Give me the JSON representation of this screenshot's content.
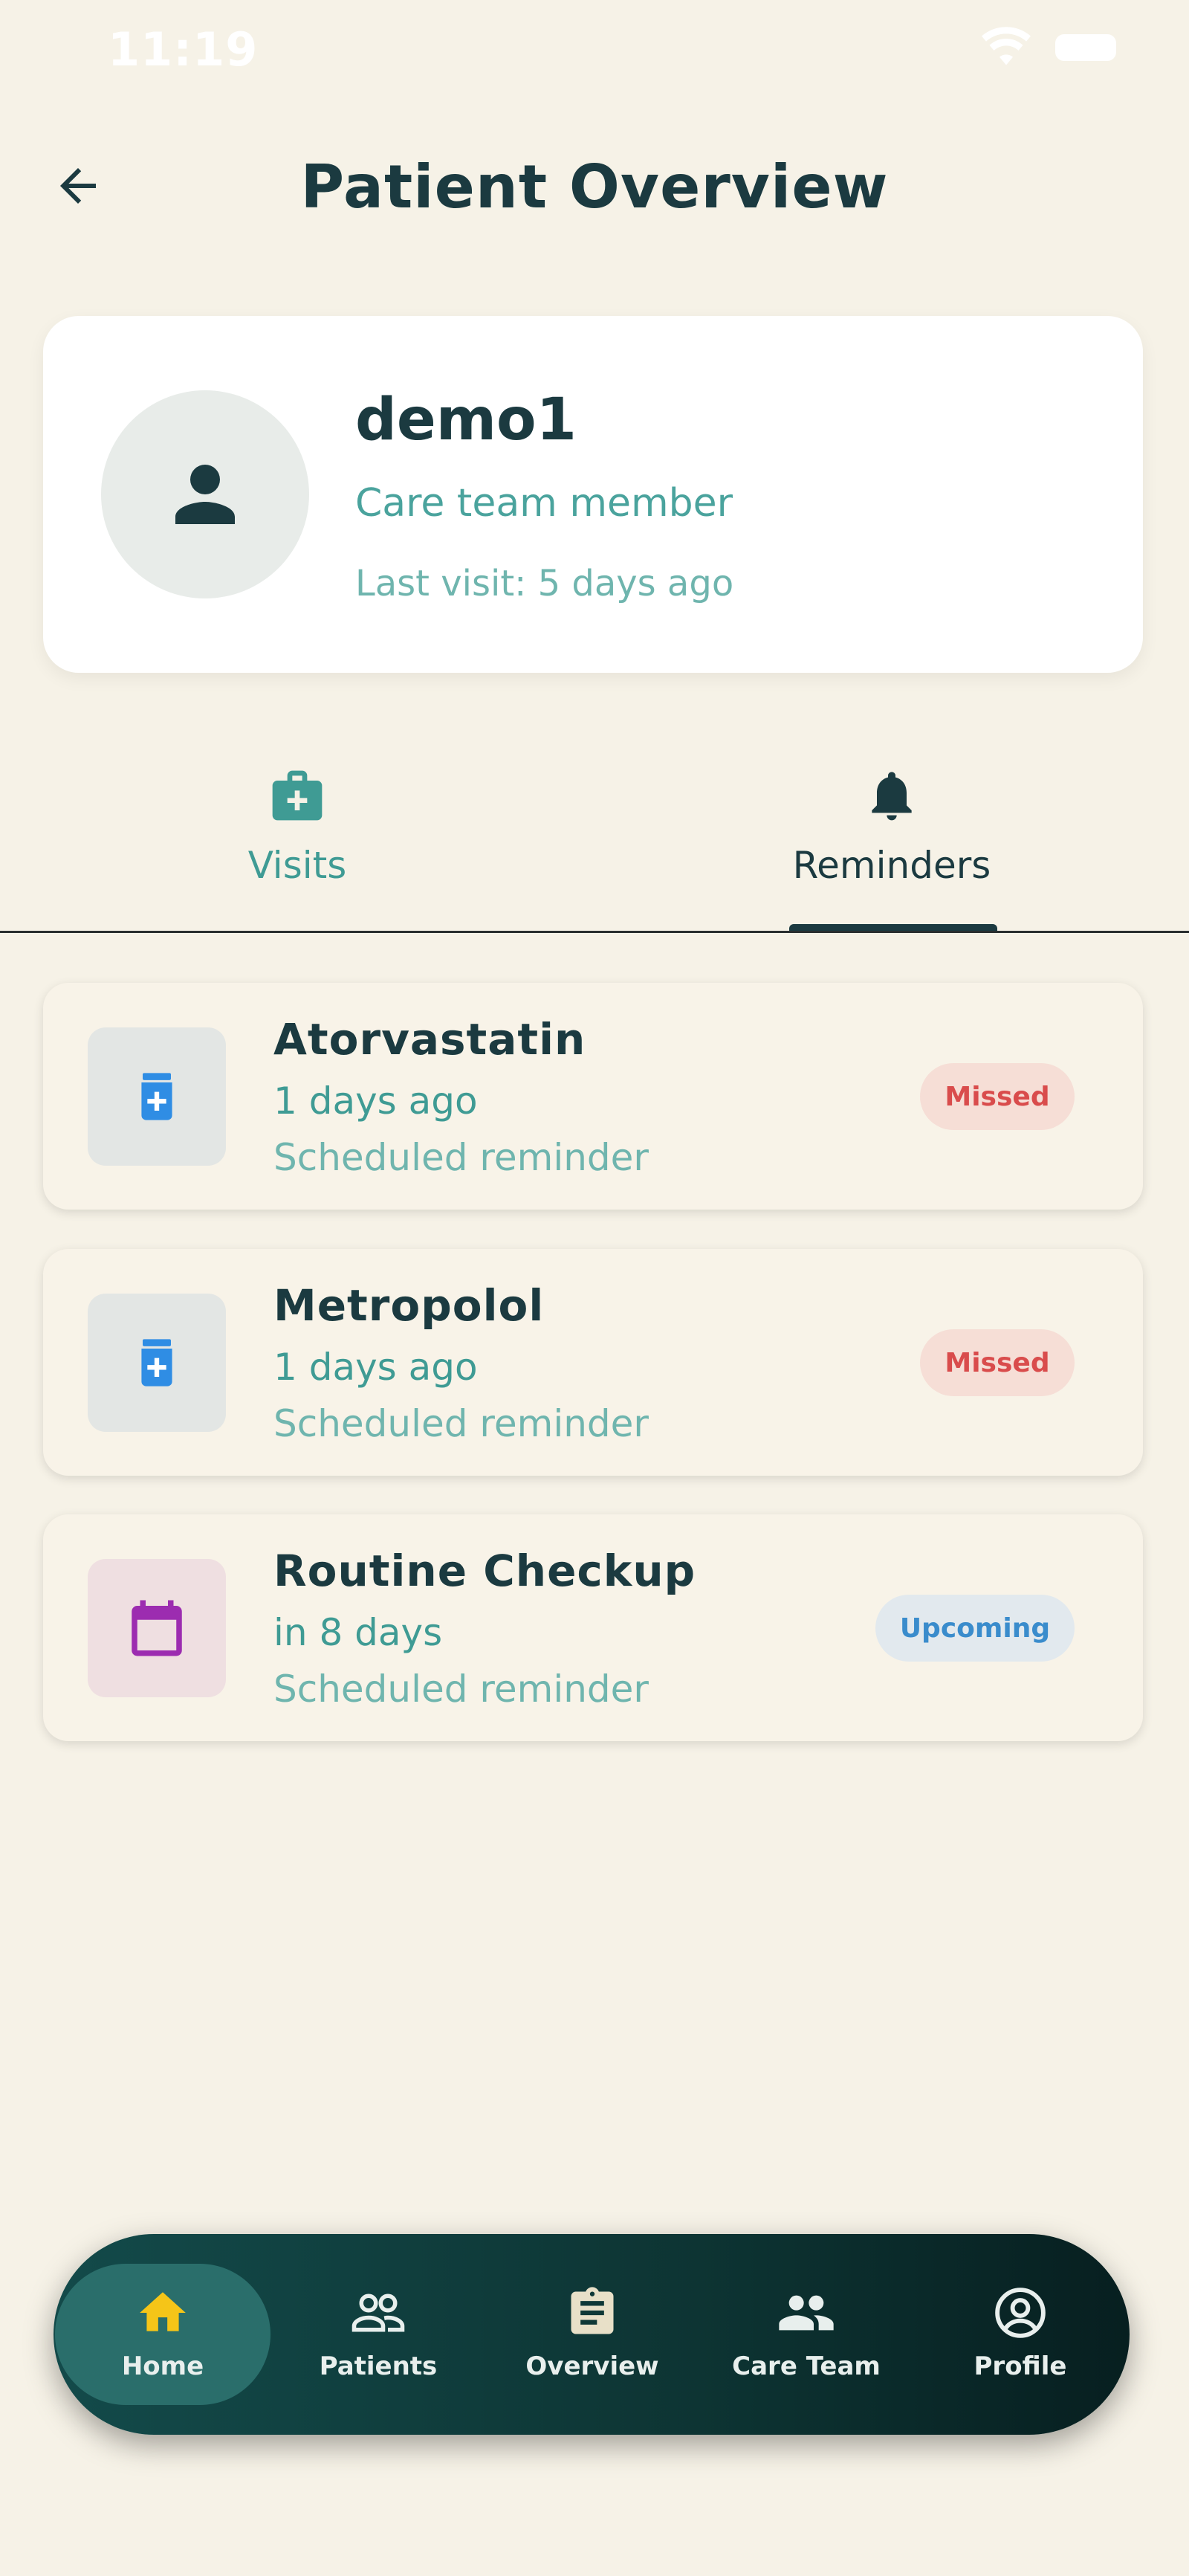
{
  "status_bar": {
    "time": "11:19"
  },
  "header": {
    "title": "Patient Overview"
  },
  "patient": {
    "name": "demo1",
    "role": "Care team member",
    "last_visit": "Last visit: 5 days ago"
  },
  "tabs": [
    {
      "label": "Visits",
      "icon": "medical-kit-icon",
      "active": false
    },
    {
      "label": "Reminders",
      "icon": "bell-icon",
      "active": true
    }
  ],
  "reminders": [
    {
      "title": "Atorvastatin",
      "time": "1 days ago",
      "subtitle": "Scheduled reminder",
      "status": "Missed",
      "icon": "medication-icon"
    },
    {
      "title": "Metropolol",
      "time": "1 days ago",
      "subtitle": "Scheduled reminder",
      "status": "Missed",
      "icon": "medication-icon"
    },
    {
      "title": "Routine Checkup",
      "time": "in 8 days",
      "subtitle": "Scheduled reminder",
      "status": "Upcoming",
      "icon": "calendar-icon"
    }
  ],
  "bottom_nav": [
    {
      "label": "Home",
      "icon": "home-icon",
      "active": true
    },
    {
      "label": "Patients",
      "icon": "patients-icon",
      "active": false
    },
    {
      "label": "Overview",
      "icon": "clipboard-icon",
      "active": false
    },
    {
      "label": "Care Team",
      "icon": "group-icon",
      "active": false
    },
    {
      "label": "Profile",
      "icon": "account-circle-icon",
      "active": false
    }
  ],
  "colors": {
    "background": "#f6f2e7",
    "accent_teal": "#3f9b94",
    "missed": "#d94c4c",
    "upcoming": "#3a8ccc",
    "nav_active_icon": "#f5c518"
  }
}
